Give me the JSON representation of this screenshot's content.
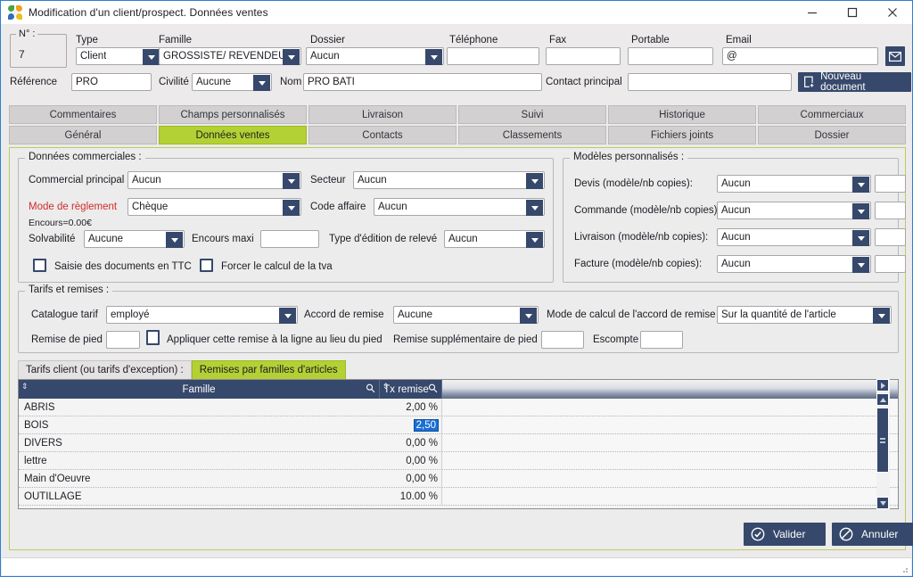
{
  "window": {
    "title": "Modification d'un client/prospect. Données ventes",
    "icon": "app-pinwheel-icon",
    "minimize": "–",
    "maximize": "□",
    "close": "✕"
  },
  "header": {
    "num": {
      "legend": "N° :",
      "value": "7"
    },
    "type": {
      "label": "Type",
      "value": "Client"
    },
    "famille": {
      "label": "Famille",
      "value": "GROSSISTE/ REVENDEUR"
    },
    "dossier": {
      "label": "Dossier",
      "value": "Aucun"
    },
    "telephone": {
      "label": "Téléphone",
      "value": ""
    },
    "fax": {
      "label": "Fax",
      "value": ""
    },
    "portable": {
      "label": "Portable",
      "value": ""
    },
    "email": {
      "label": "Email",
      "value": "@"
    },
    "reference": {
      "label": "Référence",
      "value": "PRO"
    },
    "civilite": {
      "label": "Civilité",
      "value": "Aucune"
    },
    "nom": {
      "label": "Nom",
      "value": "PRO BATI"
    },
    "contact_principal": {
      "label": "Contact principal",
      "value": ""
    },
    "nouveau_document": {
      "label": "Nouveau document"
    }
  },
  "tabs": {
    "row1": [
      "Commentaires",
      "Champs personnalisés",
      "Livraison",
      "Suivi",
      "Historique",
      "Commerciaux"
    ],
    "row2": [
      "Général",
      "Données ventes",
      "Contacts",
      "Classements",
      "Fichiers joints",
      "Dossier"
    ],
    "active": "Données ventes"
  },
  "donnees_commerciales": {
    "legend": "Données commerciales :",
    "commercial_principal": {
      "label": "Commercial principal",
      "value": "Aucun"
    },
    "secteur": {
      "label": "Secteur",
      "value": "Aucun"
    },
    "mode_reglement": {
      "label": "Mode de règlement",
      "value": "Chèque"
    },
    "code_affaire": {
      "label": "Code affaire",
      "value": "Aucun"
    },
    "encours_info": "Encours=0.00€",
    "solvabilite": {
      "label": "Solvabilité",
      "value": "Aucune"
    },
    "encours_maxi": {
      "label": "Encours maxi",
      "value": ""
    },
    "type_edition_releve": {
      "label": "Type d'édition de relevé",
      "value": "Aucun"
    },
    "saisie_ttc": {
      "label": "Saisie des documents en TTC",
      "checked": false
    },
    "forcer_tva": {
      "label": "Forcer le calcul de la tva",
      "checked": false
    }
  },
  "modeles_personnalises": {
    "legend": "Modèles personnalisés :",
    "rows": [
      {
        "label": "Devis (modèle/nb copies):",
        "value": "Aucun",
        "copies": ""
      },
      {
        "label": "Commande (modèle/nb copies):",
        "value": "Aucun",
        "copies": ""
      },
      {
        "label": "Livraison (modèle/nb copies):",
        "value": "Aucun",
        "copies": ""
      },
      {
        "label": "Facture (modèle/nb copies):",
        "value": "Aucun",
        "copies": ""
      }
    ]
  },
  "tarifs_remises": {
    "legend": "Tarifs et remises :",
    "catalogue_tarif": {
      "label": "Catalogue tarif",
      "value": "employé"
    },
    "accord_remise": {
      "label": "Accord de remise",
      "value": "Aucune"
    },
    "mode_calcul": {
      "label": "Mode de calcul de l'accord de remise",
      "value": "Sur la quantité de l'article"
    },
    "remise_pied": {
      "label": "Remise de pied",
      "value": ""
    },
    "appliquer_remise": {
      "label": "Appliquer cette remise à la ligne au lieu du pied",
      "checked": false
    },
    "remise_supp": {
      "label": "Remise supplémentaire de pied",
      "value": ""
    },
    "escompte": {
      "label": "Escompte",
      "value": ""
    }
  },
  "subtabs": {
    "items": [
      "Tarifs client (ou tarifs d'exception) :",
      "Remises par familles d'articles"
    ],
    "active": "Remises par familles d'articles"
  },
  "grid": {
    "columns": [
      "Famille",
      "Tx remise"
    ],
    "rows": [
      {
        "famille": "ABRIS",
        "tx": "2,00 %",
        "editing": false
      },
      {
        "famille": "BOIS",
        "tx": "2,50",
        "editing": true
      },
      {
        "famille": "DIVERS",
        "tx": "0,00 %",
        "editing": false
      },
      {
        "famille": "lettre",
        "tx": "0,00 %",
        "editing": false
      },
      {
        "famille": "Main d'Oeuvre",
        "tx": "0,00 %",
        "editing": false
      },
      {
        "famille": "OUTILLAGE",
        "tx": "10.00 %",
        "editing": false
      }
    ]
  },
  "footer": {
    "valider": "Valider",
    "annuler": "Annuler"
  },
  "colors": {
    "accent_green": "#b3d135",
    "navy": "#36486b",
    "red_label": "#d22b2b",
    "selection_blue": "#1a6fd4",
    "title_border": "#2a7fd4"
  }
}
